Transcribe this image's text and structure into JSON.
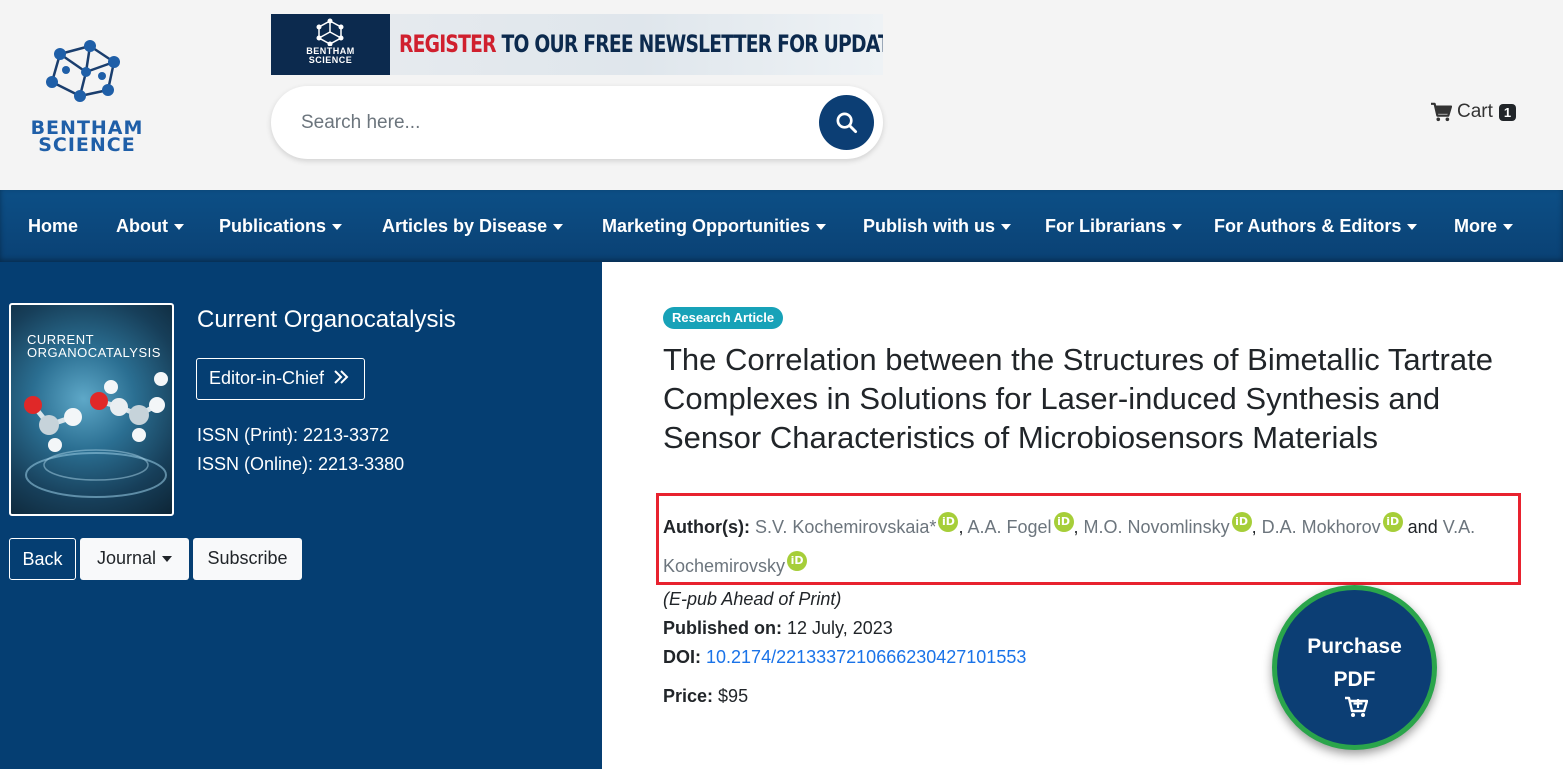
{
  "header": {
    "logo_text": [
      "BENTHAM",
      "SCIENCE"
    ],
    "banner": {
      "logo_text": [
        "BENTHAM",
        "SCIENCE"
      ],
      "headline_red": "REGISTER",
      "headline_dark": "TO OUR FREE NEWSLETTER FOR UPDATES"
    },
    "search": {
      "placeholder": "Search here...",
      "icon": "search-icon"
    },
    "cart": {
      "label": "Cart",
      "count": "1",
      "icon": "cart-icon"
    }
  },
  "nav": {
    "items": [
      {
        "label": "Home",
        "dropdown": false
      },
      {
        "label": "About",
        "dropdown": true
      },
      {
        "label": "Publications",
        "dropdown": true
      },
      {
        "label": "Articles by Disease",
        "dropdown": true
      },
      {
        "label": "Marketing Opportunities",
        "dropdown": true
      },
      {
        "label": "Publish with us",
        "dropdown": true
      },
      {
        "label": "For Librarians",
        "dropdown": true
      },
      {
        "label": "For Authors & Editors",
        "dropdown": true
      },
      {
        "label": "More",
        "dropdown": true
      }
    ]
  },
  "journal": {
    "cover_title_1": "CURRENT",
    "cover_title_2": "ORGANOCATALYSIS",
    "title": "Current Organocatalysis",
    "eic_button": "Editor-in-Chief",
    "issn_print": "ISSN (Print): 2213-3372",
    "issn_online": "ISSN (Online): 2213-3380",
    "buttons": {
      "back": "Back",
      "journal": "Journal",
      "subscribe": "Subscribe"
    }
  },
  "article": {
    "type_badge": "Research Article",
    "title": "The Correlation between the Structures of Bimetallic Tartrate Complexes in Solutions for Laser-induced Synthesis and Sensor Characteristics of Microbiosensors Materials",
    "authors_label": "Author(s):",
    "authors": [
      "S.V. Kochemirovskaia*",
      "A.A. Fogel",
      "M.O. Novomlinsky",
      "D.A. Mokhorov",
      "V.A. Kochemirovsky"
    ],
    "separator": ",",
    "conjunction": "and",
    "orcid_label": "iD",
    "epub": "(E-pub Ahead of Print)",
    "published_label": "Published on:",
    "published_date": "12 July, 2023",
    "doi_label": "DOI:",
    "doi": "10.2174/2213337210666230427101553",
    "price_label": "Price:",
    "price": "$95"
  },
  "purchase": {
    "line1": "Purchase",
    "line2": "PDF",
    "icon": "add-to-cart-icon"
  },
  "colors": {
    "navbar": "#0a4174",
    "left_panel": "#053e72",
    "badge": "#17a2b8",
    "orcid": "#a6ce39",
    "highlight_box": "#e8222f",
    "purchase_ring": "#2aa54b"
  }
}
